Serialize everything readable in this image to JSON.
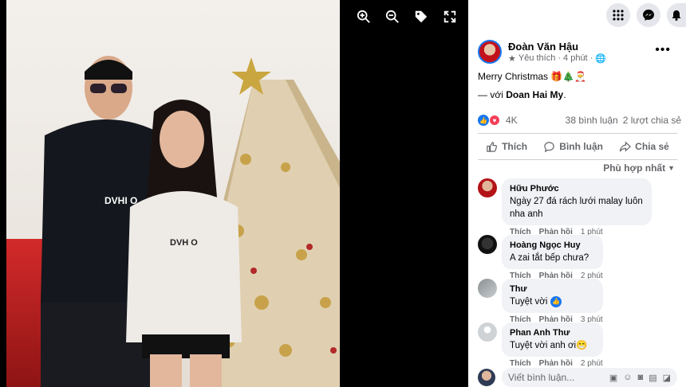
{
  "viewer": {
    "tools": [
      {
        "name": "zoom-in-icon"
      },
      {
        "name": "zoom-out-icon"
      },
      {
        "name": "tag-icon"
      },
      {
        "name": "fullscreen-icon"
      }
    ],
    "photo_text": {
      "hoodie1": "DVHI O",
      "hoodie2": "DVH O"
    }
  },
  "topbar": {
    "icons": [
      "menu-grid-icon",
      "messenger-icon",
      "notifications-icon"
    ]
  },
  "post": {
    "author": "Đoàn Văn Hậu",
    "follow": "Yêu thích",
    "time": "4 phút",
    "text": "Merry Christmas 🎁🎄🎅",
    "with_prefix": "— với ",
    "with_name": "Doan Hai My",
    "with_suffix": ".",
    "reaction_count": "4K",
    "comments_count": "38 bình luận",
    "shares_count": "2 lượt chia sẻ",
    "like_label": "Thích",
    "comment_label": "Bình luận",
    "share_label": "Chia sẻ",
    "sort_label": "Phù hợp nhất"
  },
  "comments": [
    {
      "name": "Hữu Phước",
      "text": "Ngày 27 đá rách lưới malay luôn nha anh",
      "like": "Thích",
      "reply": "Phản hồi",
      "time": "1 phút"
    },
    {
      "name": "Hoàng Ngọc Huy",
      "text": "A zai tắt bếp chưa?",
      "like": "Thích",
      "reply": "Phản hồi",
      "time": "2 phút"
    },
    {
      "name": "Thư",
      "text": "Tuyệt vời",
      "like": "Thích",
      "reply": "Phản hồi",
      "time": "3 phút"
    },
    {
      "name": "Phan Anh Thư",
      "text": "Tuyệt vời anh ơi😁",
      "like": "Thích",
      "reply": "Phản hồi",
      "time": "2 phút"
    }
  ],
  "composer": {
    "placeholder": "Viết bình luận..."
  },
  "colors": {
    "accent": "#1877f2",
    "text": "#050505",
    "muted": "#65676b",
    "bubble": "#f0f2f5"
  }
}
